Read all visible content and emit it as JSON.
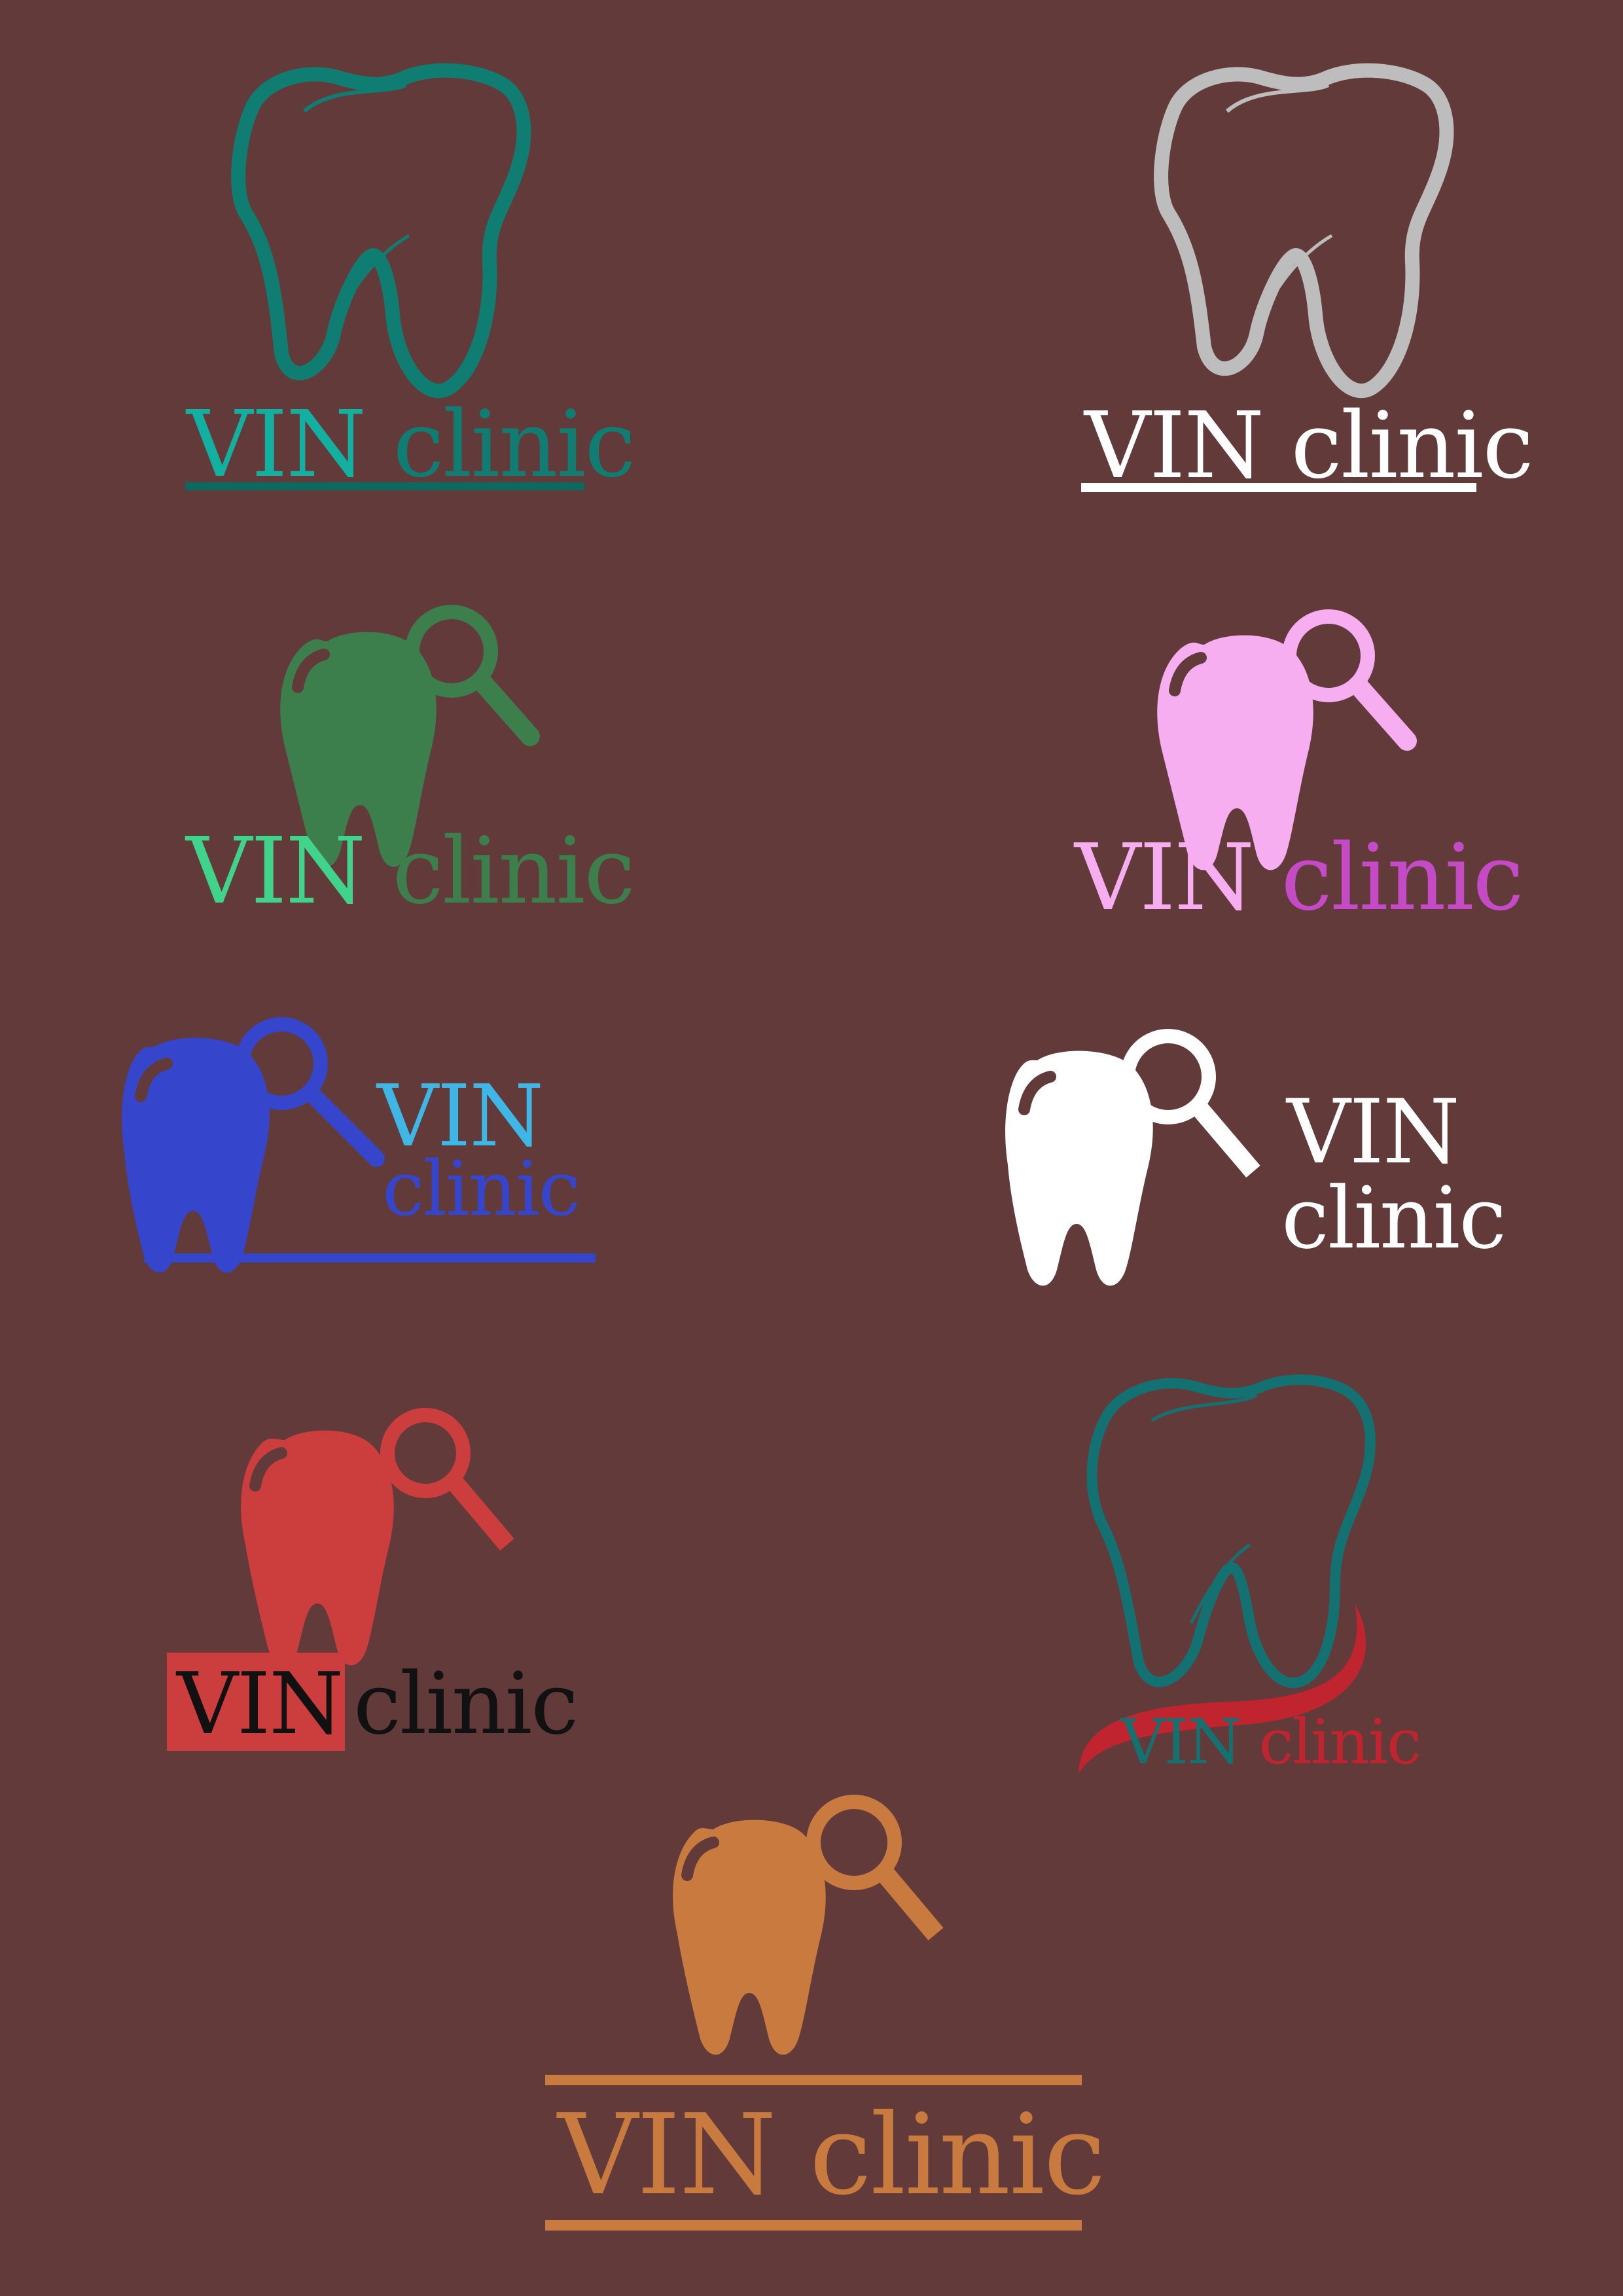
{
  "palette": {
    "background": "#633a3a",
    "teal": "#0f7d72",
    "teal_text": "#12b0a0",
    "silver": "#bdbdbd",
    "white": "#ffffff",
    "green": "#3c7f4c",
    "green_light": "#3fd38c",
    "pink": "#f6aef0",
    "magenta": "#c44ac6",
    "royal_blue": "#3546cc",
    "sky_blue": "#3fb7e6",
    "red": "#cc3e3e",
    "black": "#111111",
    "dark_teal": "#147172",
    "crimson": "#c0242f",
    "orange": "#c87a3f"
  },
  "logos": [
    {
      "icon": "tooth-outline-icon",
      "word1": "VIN",
      "word2": "clinic",
      "colors": [
        "#0f7d72",
        "#12b0a0",
        "#0f7d72",
        "#0b6a60"
      ]
    },
    {
      "icon": "tooth-outline-icon",
      "word1": "VIN",
      "word2": "clinic",
      "colors": [
        "#bdbdbd",
        "#ffffff",
        "#ffffff",
        "#ffffff"
      ]
    },
    {
      "icon": "tooth-magnifier-icon",
      "word1": "VIN",
      "word2": "clinic",
      "colors": [
        "#3c7f4c",
        "#3fd38c",
        "#3c7f4c"
      ]
    },
    {
      "icon": "tooth-magnifier-icon",
      "word1": "VIN",
      "word2": "clinic",
      "colors": [
        "#f6aef0",
        "#f6aef0",
        "#c44ac6"
      ]
    },
    {
      "icon": "tooth-magnifier-icon",
      "word1": "VIN",
      "word2": "clinic",
      "colors": [
        "#3546cc",
        "#3fb7e6",
        "#3546cc",
        "#3546cc"
      ]
    },
    {
      "icon": "tooth-magnifier-icon",
      "word1": "VIN",
      "word2": "clinic",
      "colors": [
        "#ffffff",
        "#ffffff",
        "#ffffff"
      ]
    },
    {
      "icon": "tooth-magnifier-icon",
      "word1": "VIN",
      "word2": "clinic",
      "colors": [
        "#cc3e3e",
        "#111111",
        "#111111",
        "#cc3e3e"
      ]
    },
    {
      "icon": "tooth-outline-swoosh-icon",
      "word1": "VIN",
      "word2": "clinic",
      "colors": [
        "#147172",
        "#147172",
        "#c0242f",
        "#c0242f"
      ]
    },
    {
      "icon": "tooth-magnifier-icon",
      "word1": "VIN",
      "word2": "clinic",
      "colors": [
        "#c87a3f",
        "#c87a3f",
        "#c87a3f",
        "#c87a3f"
      ]
    }
  ]
}
